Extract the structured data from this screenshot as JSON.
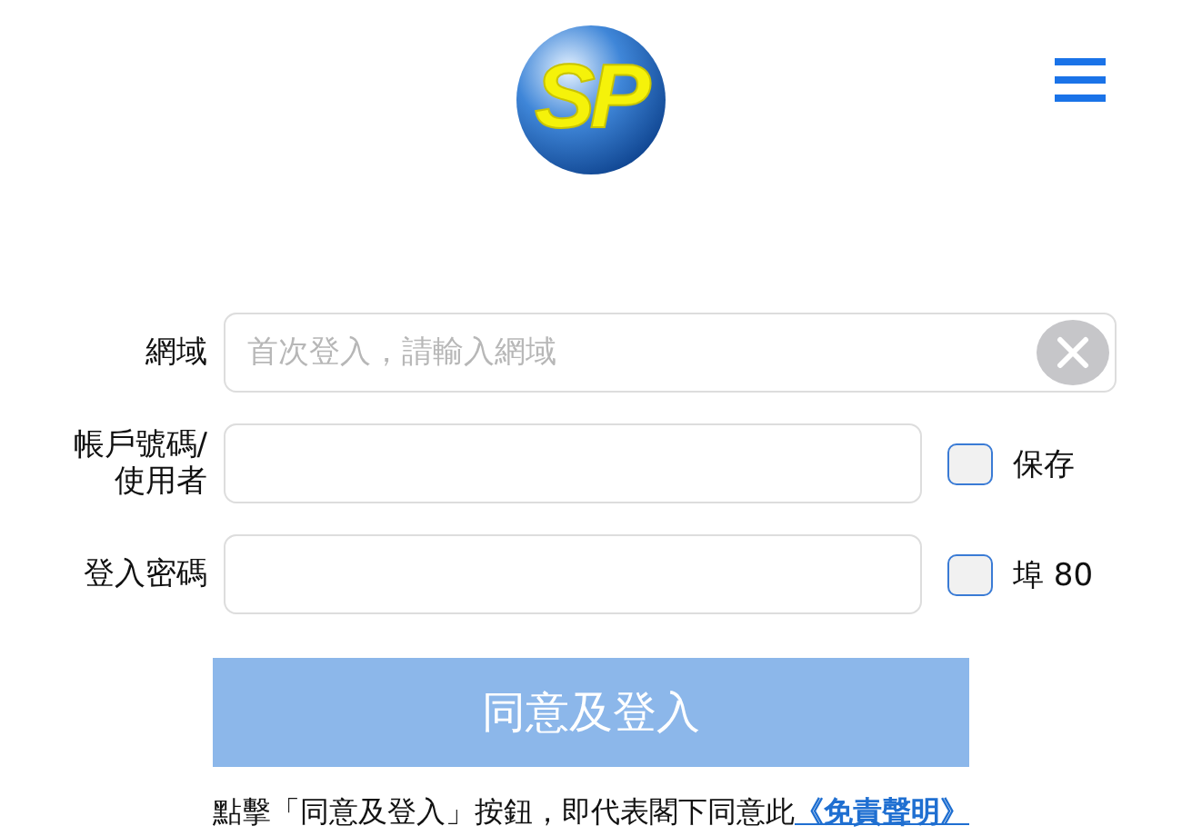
{
  "header": {
    "logo_text": "SP"
  },
  "form": {
    "fields": [
      {
        "label": "網域",
        "placeholder": "首次登入，請輸入網域",
        "clear_button": true
      },
      {
        "label": "帳戶號碼/使用者",
        "option": {
          "label": "保存",
          "checked": false
        }
      },
      {
        "label": "登入密碼",
        "option": {
          "label": "埠 80",
          "checked": false
        }
      }
    ]
  },
  "submit": {
    "label": "同意及登入",
    "disabled": true
  },
  "notice": {
    "text": "點擊「同意及登入」按鈕，即代表閣下同意此",
    "link": "《免責聲明》"
  }
}
